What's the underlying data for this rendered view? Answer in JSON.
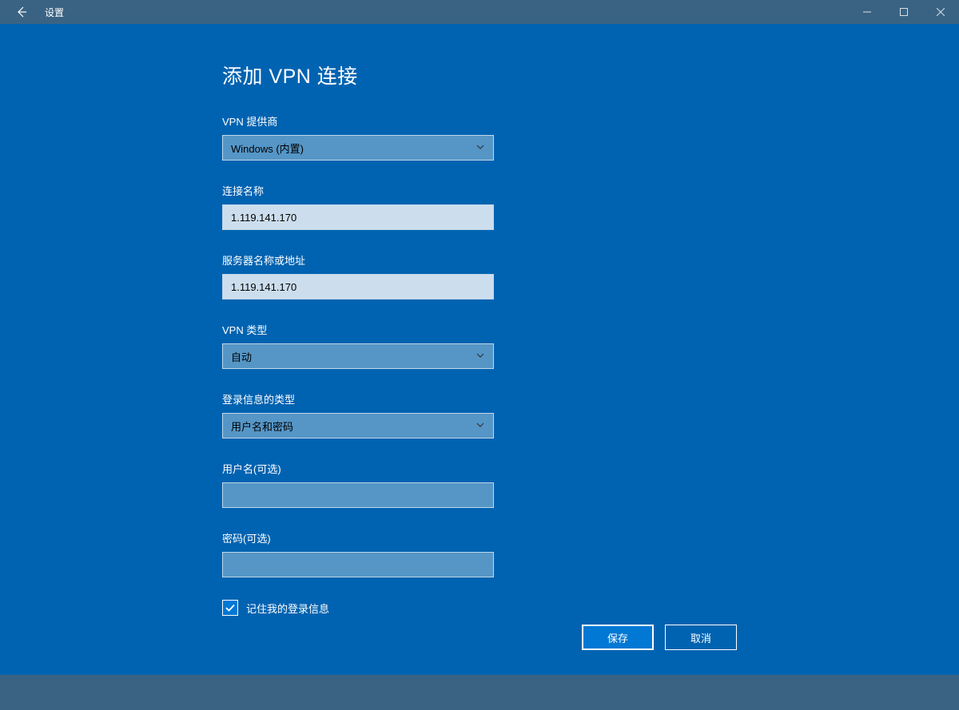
{
  "titlebar": {
    "title": "设置"
  },
  "page": {
    "title": "添加 VPN 连接"
  },
  "fields": {
    "provider": {
      "label": "VPN 提供商",
      "value": "Windows (内置)"
    },
    "connection_name": {
      "label": "连接名称",
      "value": "1.119.141.170"
    },
    "server": {
      "label": "服务器名称或地址",
      "value": "1.119.141.170"
    },
    "vpn_type": {
      "label": "VPN 类型",
      "value": "自动"
    },
    "signin_type": {
      "label": "登录信息的类型",
      "value": "用户名和密码"
    },
    "username": {
      "label": "用户名(可选)",
      "value": ""
    },
    "password": {
      "label": "密码(可选)",
      "value": ""
    },
    "remember": {
      "label": "记住我的登录信息",
      "checked": true
    }
  },
  "buttons": {
    "save": "保存",
    "cancel": "取消"
  }
}
